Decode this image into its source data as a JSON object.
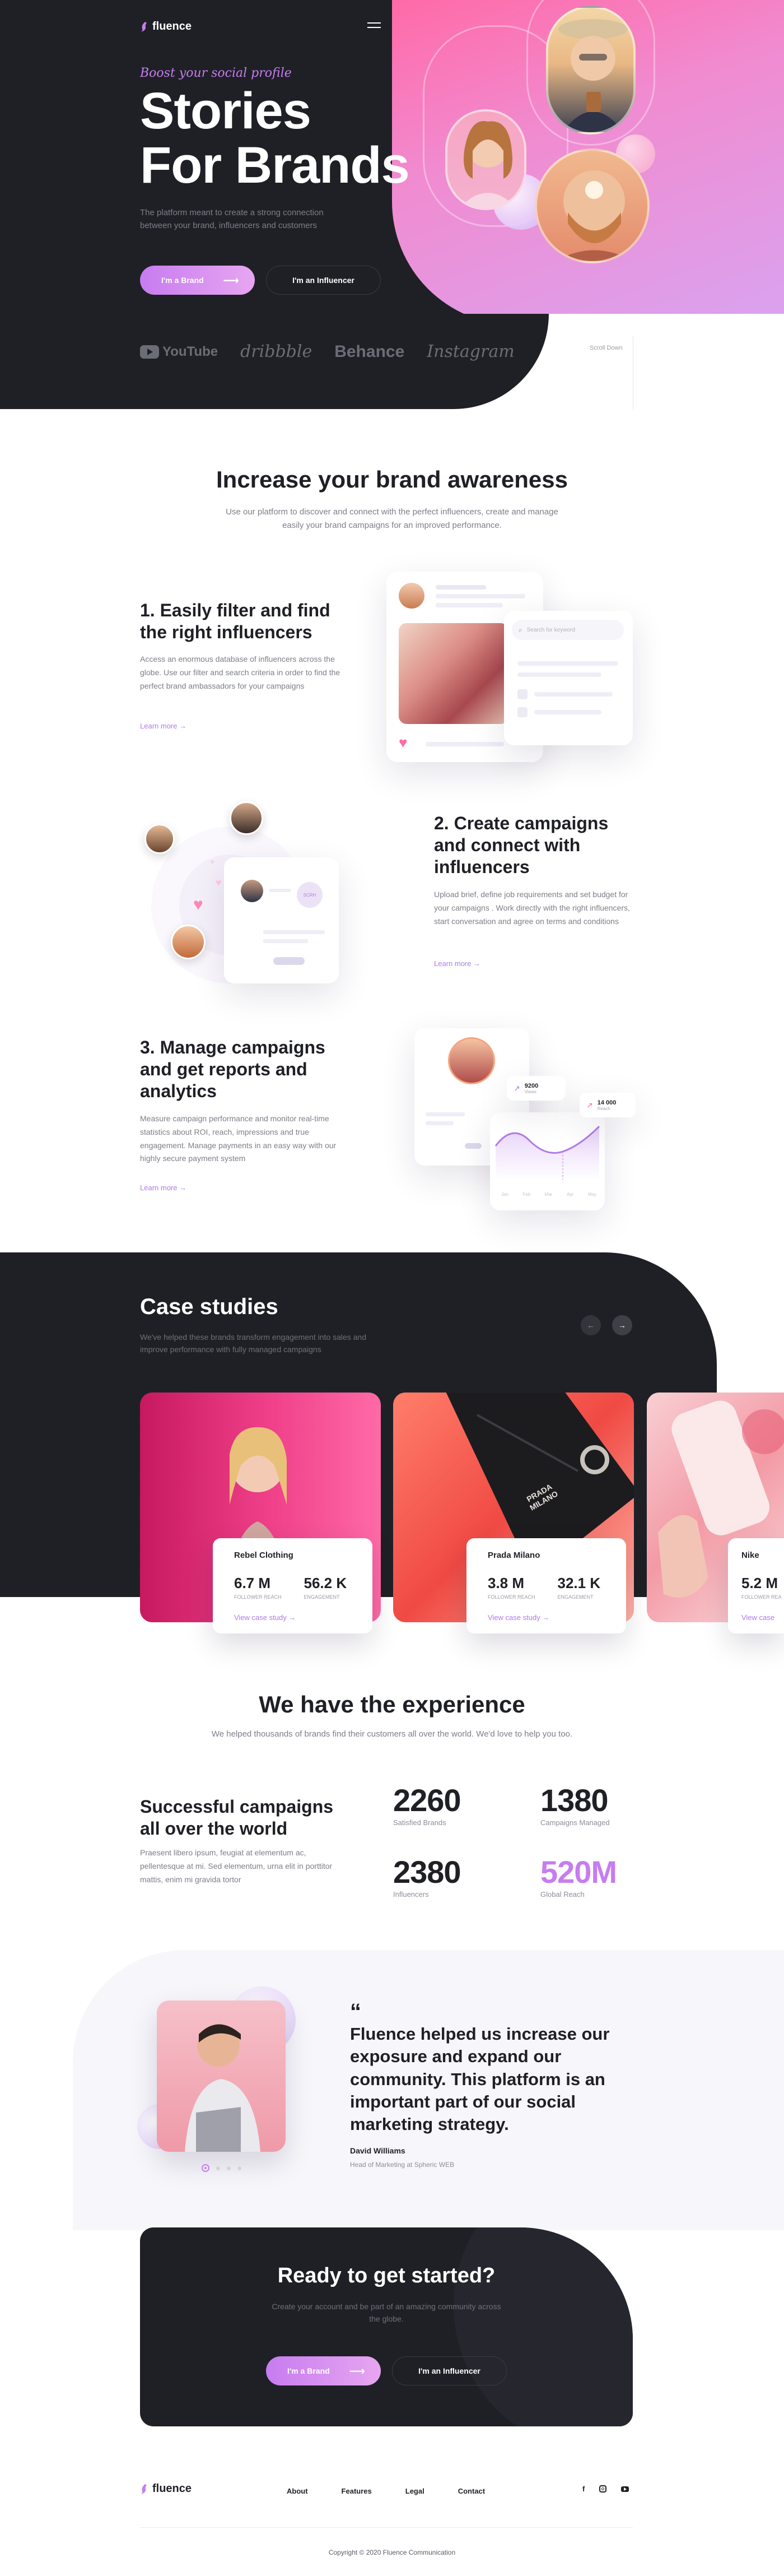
{
  "brand": {
    "name": "fluence"
  },
  "hero": {
    "script_tagline": "Boost your social profile",
    "title_line1": "Stories",
    "title_line2": "For Brands",
    "subtitle": "The platform meant to create a strong connection between your brand, influencers and customers",
    "btn_brand": "I'm a Brand",
    "btn_influencer": "I'm an Influencer",
    "logos": [
      "YouTube",
      "dribbble",
      "Behance",
      "Instagram"
    ],
    "scroll_down": "Scroll Down"
  },
  "awareness": {
    "title": "Increase your brand awareness",
    "subtitle": "Use our platform to discover and connect with the perfect influencers, create and manage easily your brand campaigns for an improved performance."
  },
  "features": [
    {
      "title": "1. Easily filter and  find the right influencers",
      "text": "Access an enormous database of influencers across the globe. Use our filter and search criteria in order to find the perfect brand ambassadors for your campaigns",
      "link": "Learn more",
      "search_placeholder": "Search for keyword"
    },
    {
      "title": "2. Create campaigns and connect with influencers",
      "text": "Upload brief, define job requirements and set budget for your campaigns . Work directly with the right influencers, start conversation and agree on terms and conditions",
      "link": "Learn more",
      "badge": "SCRH"
    },
    {
      "title": "3. Manage campaigns and get reports and analytics",
      "text": "Measure campaign performance and monitor real-time statistics about ROI, reach, impressions and true engagement. Manage payments in an easy way with our highly secure payment system",
      "link": "Learn more",
      "stat1_value": "9200",
      "stat1_label": "Views",
      "stat2_value": "14 000",
      "stat2_label": "Reach",
      "months": [
        "Jan",
        "Feb",
        "Mar",
        "Apr",
        "May"
      ]
    }
  ],
  "case_studies": {
    "title": "Case studies",
    "subtitle": "We've helped these brands transform engagement into sales and improve performance with fully managed campaigns",
    "cards": [
      {
        "brand": "Rebel Clothing",
        "reach": "6.7 M",
        "reach_label": "FOLLOWER REACH",
        "engagement": "56.2 K",
        "engagement_label": "ENGAGEMENT",
        "link": "View case study"
      },
      {
        "brand": "Prada Milano",
        "reach": "3.8 M",
        "reach_label": "FOLLOWER REACH",
        "engagement": "32.1 K",
        "engagement_label": "ENGAGEMENT",
        "link": "View case study"
      },
      {
        "brand": "Nike",
        "reach": "5.2 M",
        "reach_label": "FOLLOWER REA",
        "engagement": "",
        "engagement_label": "",
        "link": "View case"
      }
    ],
    "bag_text": "PRADA MILANO"
  },
  "experience": {
    "title": "We have the experience",
    "subtitle": "We helped thousands of brands find their customers all over the world. We'd love to help you too.",
    "left_title": "Successful campaigns all over the world",
    "left_text": "Praesent libero ipsum, feugiat at elementum ac, pellentesque at mi. Sed elementum, urna elit in porttitor mattis, enim mi gravida tortor",
    "stats": [
      {
        "value": "2260",
        "label": "Satisfied Brands"
      },
      {
        "value": "1380",
        "label": "Campaigns Managed"
      },
      {
        "value": "2380",
        "label": "Influencers"
      },
      {
        "value": "520M",
        "label": "Global Reach"
      }
    ]
  },
  "testimonial": {
    "quote_mark": "“",
    "quote": "Fluence helped us increase our exposure and expand our community. This platform is an important part of our social marketing strategy.",
    "author": "David Williams",
    "role": "Head of Marketing at Spheric WEB"
  },
  "cta": {
    "title": "Ready to get started?",
    "subtitle": "Create your account and be part of an amazing community across the globe.",
    "btn_brand": "I'm a Brand",
    "btn_influencer": "I'm an Influencer"
  },
  "footer": {
    "links": [
      "About",
      "Features",
      "Legal",
      "Contact"
    ],
    "copyright": "Copyright © 2020 Fluence Communication"
  },
  "colors": {
    "dark": "#1f2026",
    "accent_purple": "#c77cf0",
    "accent_pink": "#ff6aa7"
  }
}
